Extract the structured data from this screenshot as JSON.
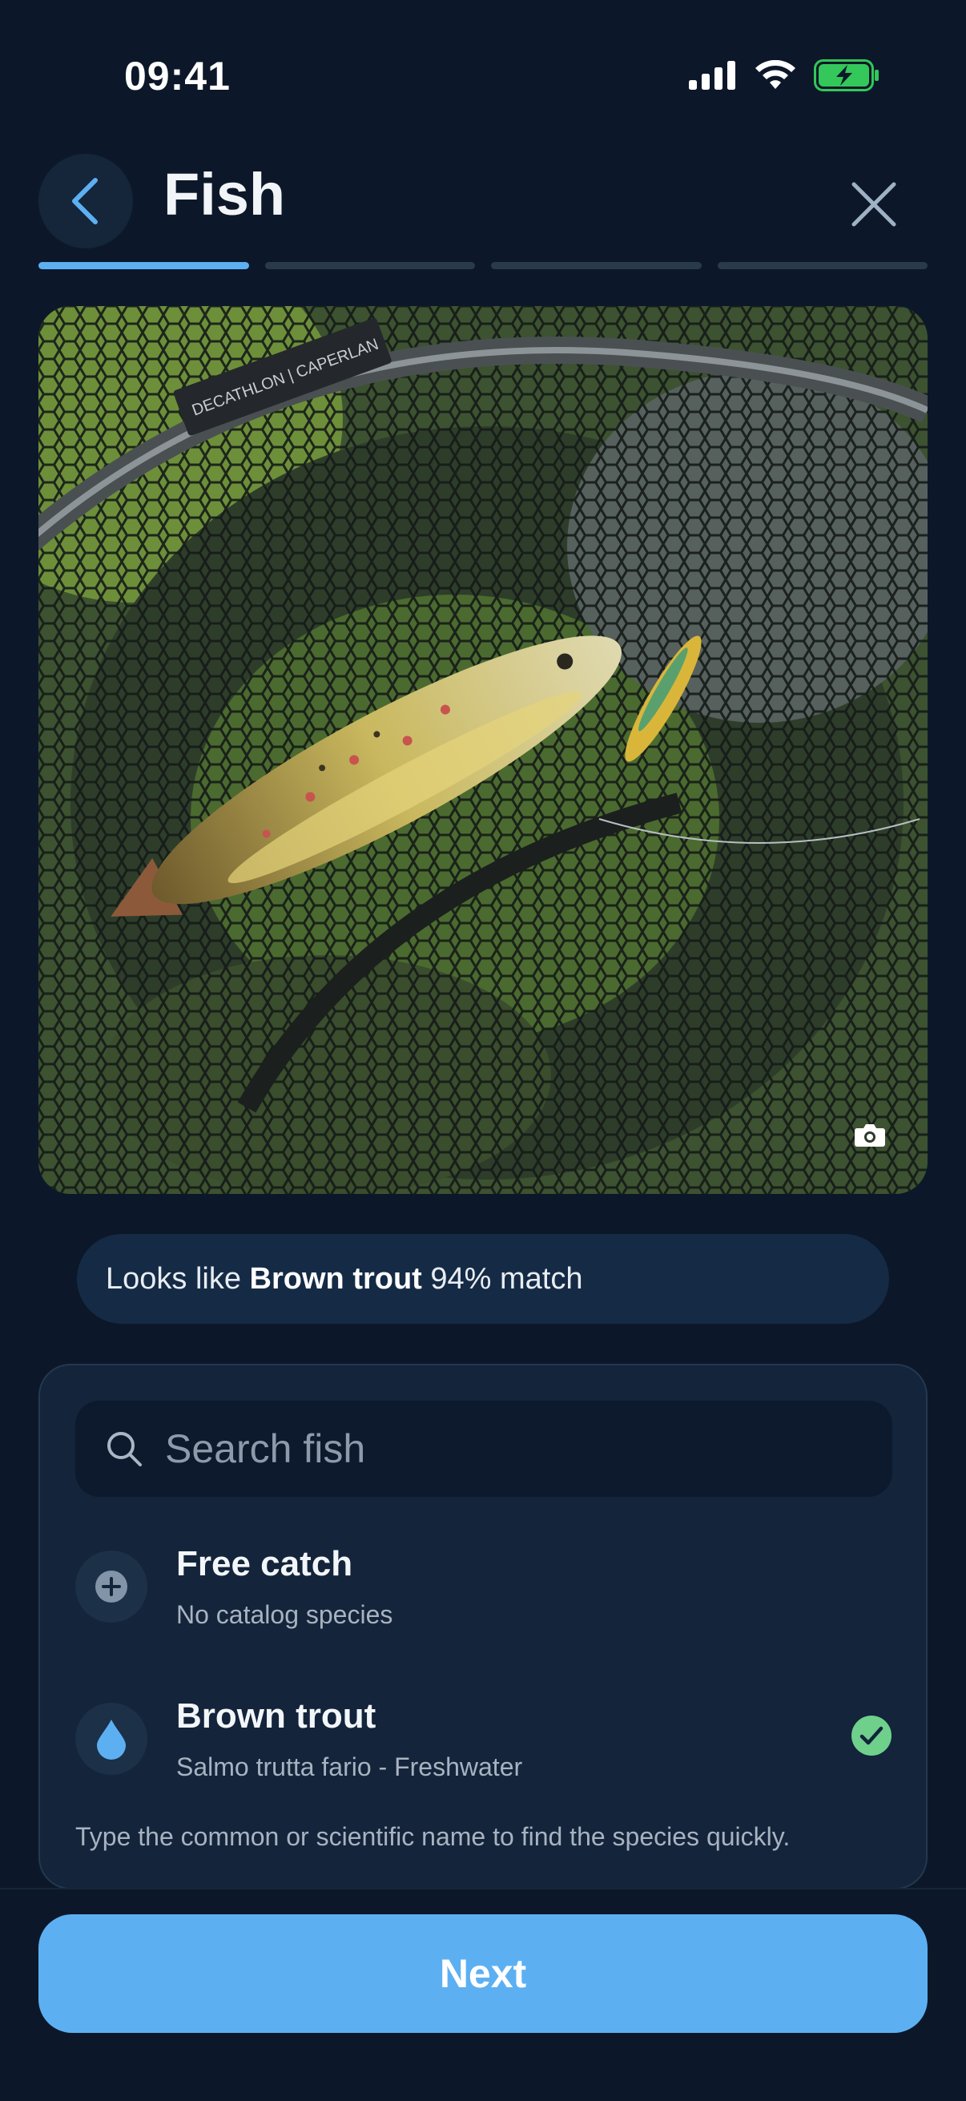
{
  "status_bar": {
    "time": "09:41",
    "signal_icon": "cellular-signal-icon",
    "wifi_icon": "wifi-icon",
    "battery_icon": "battery-charging-icon",
    "battery_color": "#34c759"
  },
  "header": {
    "title": "Fish",
    "back_icon": "chevron-left-icon",
    "close_icon": "close-icon",
    "steps_total": 4,
    "current_step": 1
  },
  "photo": {
    "net_label": "DECATHLON | CAPERLAN",
    "camera_icon": "camera-icon"
  },
  "match": {
    "prefix": "Looks like",
    "species": "Brown trout",
    "suffix": "94% match"
  },
  "search": {
    "icon": "search-icon",
    "placeholder": "Search fish"
  },
  "species_list": [
    {
      "title": "Free catch",
      "subtitle": "No catalog species",
      "icon": "plus-icon",
      "selected": false
    },
    {
      "title": "Brown trout",
      "subtitle": "Salmo trutta fario - Freshwater",
      "icon": "water-drop-icon",
      "selected": true
    }
  ],
  "hint": "Type the common or scientific name to find the species quickly.",
  "next_button": "Next",
  "colors": {
    "background": "#0c1829",
    "accent": "#5cb0f2",
    "check": "#6fd08c",
    "panel": "#13243b"
  }
}
